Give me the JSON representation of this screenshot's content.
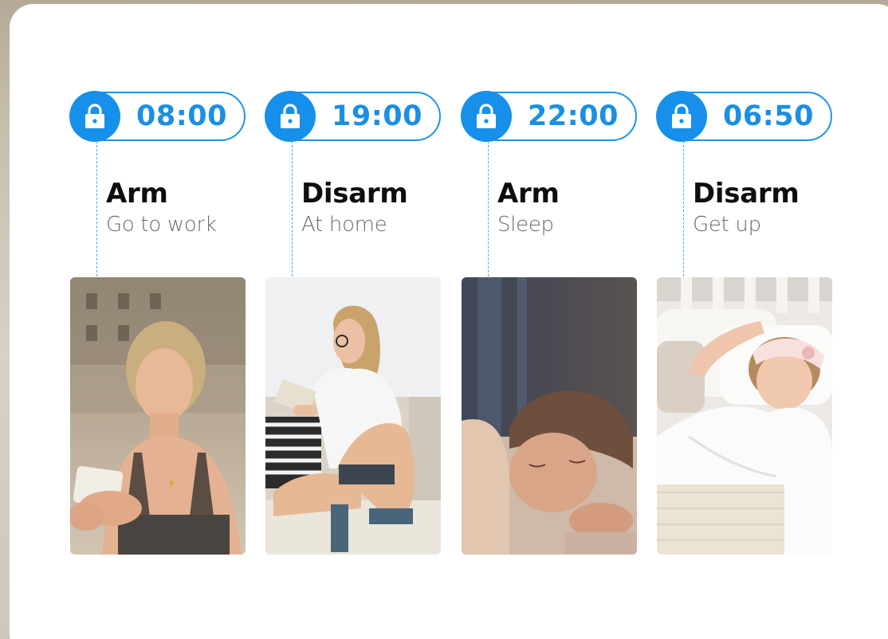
{
  "schedule": [
    {
      "time": "08:00",
      "action": "Arm",
      "description": "Go to work",
      "icon": "lock-icon",
      "photo": "woman-outdoors-phone"
    },
    {
      "time": "19:00",
      "action": "Disarm",
      "description": "At home",
      "icon": "lock-icon",
      "photo": "woman-reading-sofa"
    },
    {
      "time": "22:00",
      "action": "Arm",
      "description": "Sleep",
      "icon": "lock-icon",
      "photo": "girl-sleeping"
    },
    {
      "time": "06:50",
      "action": "Disarm",
      "description": "Get up",
      "icon": "lock-icon",
      "photo": "girl-waking-bed"
    }
  ],
  "colors": {
    "accent": "#1690ea",
    "time_text": "#1b8fe2",
    "title_text": "#0e0e0e",
    "subtitle_text": "#6a6a6a"
  }
}
